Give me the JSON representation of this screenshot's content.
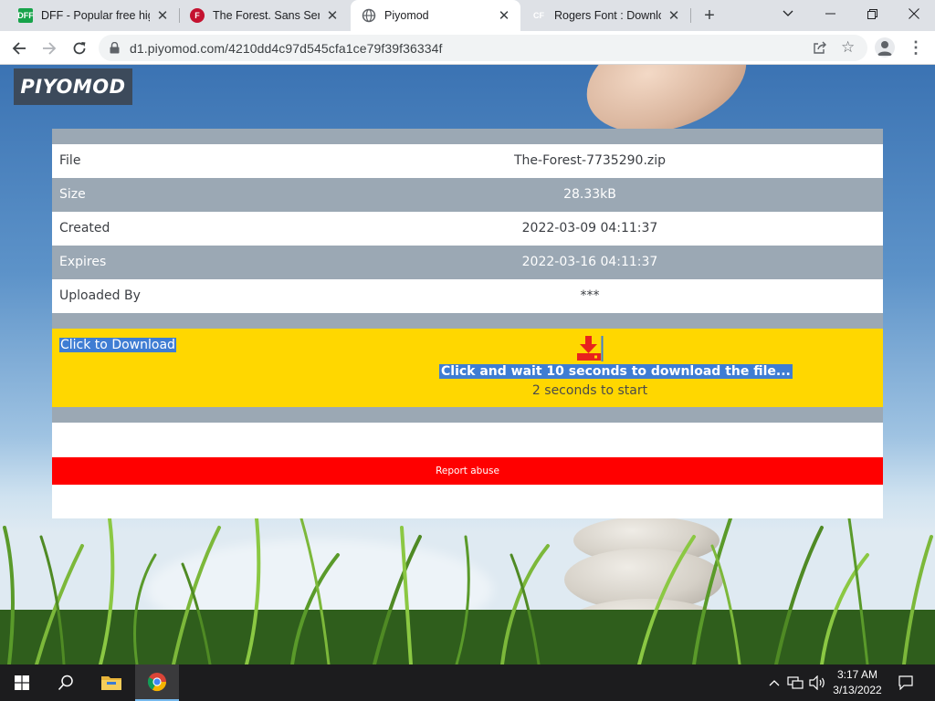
{
  "browser": {
    "tabs": [
      {
        "title": "DFF - Popular free high",
        "favicon": "dff-favicon",
        "fav_text": "DFF",
        "active": false
      },
      {
        "title": "The Forest. Sans Serif B",
        "favicon": "f-favicon",
        "fav_text": "F",
        "active": false
      },
      {
        "title": "Piyomod",
        "favicon": "globe-favicon",
        "fav_text": "",
        "active": true
      },
      {
        "title": "Rogers Font : Downloa",
        "favicon": "cf-favicon",
        "fav_text": "CF",
        "active": false
      }
    ],
    "new_tab_icon": "plus-icon",
    "window_controls": [
      "chevron-down-icon",
      "minimize-icon",
      "restore-icon",
      "close-icon"
    ],
    "url": "d1.piyomod.com/4210dd4c97d545cfa1ce79f39f36334f"
  },
  "page": {
    "logo_text": "PIYOMOD",
    "file_rows": [
      {
        "label": "File",
        "value": "The-Forest-7735290.zip"
      },
      {
        "label": "Size",
        "value": "28.33kB"
      },
      {
        "label": "Created",
        "value": "2022-03-09 04:11:37"
      },
      {
        "label": "Expires",
        "value": "2022-03-16 04:11:37"
      },
      {
        "label": "Uploaded By",
        "value": "***"
      }
    ],
    "download": {
      "link_text": "Click to Download",
      "icon": "download-icon",
      "message": "Click and wait 10 seconds to download the file...",
      "countdown": "2 seconds to start"
    },
    "report_label": "Report abuse",
    "colors": {
      "highlight": "#ffd700",
      "report": "#ff0000",
      "stripe": "#9ba8b4",
      "selection": "#3f7dd3"
    }
  },
  "taskbar": {
    "pinned": [
      "windows-start-icon",
      "search-icon",
      "file-explorer-icon",
      "chrome-icon"
    ],
    "tray": [
      "chevron-up-icon",
      "network-icon",
      "volume-icon",
      "notification-icon"
    ],
    "time": "3:17 AM",
    "date": "3/13/2022"
  }
}
